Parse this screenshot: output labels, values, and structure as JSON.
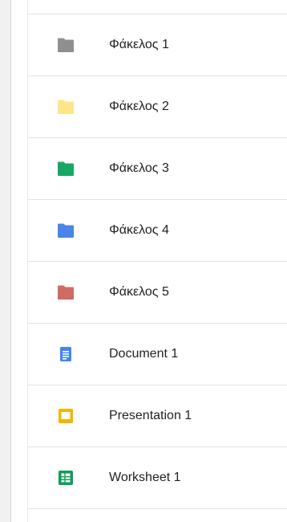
{
  "items": [
    {
      "label": "Φάκελος 1",
      "kind": "folder",
      "icon": "folder-icon-gray",
      "color": "#8f8f8f"
    },
    {
      "label": "Φάκελος 2",
      "kind": "folder",
      "icon": "folder-icon-yellow",
      "color": "#fde68a"
    },
    {
      "label": "Φάκελος 3",
      "kind": "folder",
      "icon": "folder-icon-green",
      "color": "#16a765"
    },
    {
      "label": "Φάκελος 4",
      "kind": "folder",
      "icon": "folder-icon-blue",
      "color": "#4986e7"
    },
    {
      "label": "Φάκελος 5",
      "kind": "folder",
      "icon": "folder-icon-red",
      "color": "#d06b64"
    },
    {
      "label": "Document 1",
      "kind": "document",
      "icon": "docs-icon",
      "color": "#4285f4"
    },
    {
      "label": "Presentation 1",
      "kind": "presentation",
      "icon": "slides-icon",
      "color": "#f4b400"
    },
    {
      "label": "Worksheet 1",
      "kind": "spreadsheet",
      "icon": "sheets-icon",
      "color": "#0f9d58"
    }
  ]
}
